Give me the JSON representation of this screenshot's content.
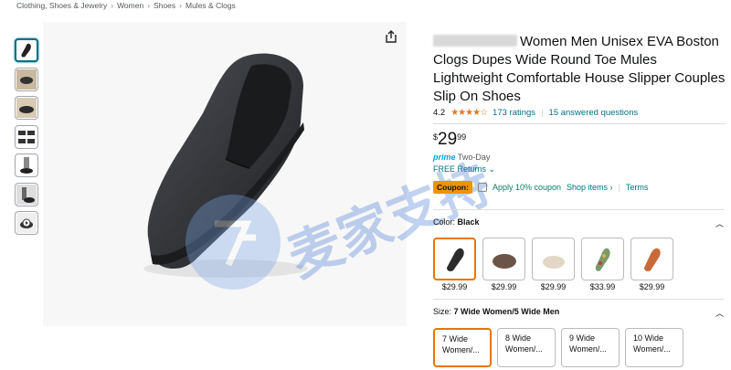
{
  "breadcrumb": [
    "Clothing, Shoes & Jewelry",
    "Women",
    "Shoes",
    "Mules & Clogs"
  ],
  "product": {
    "title": "Women Men Unisex EVA Boston Clogs Dupes Wide Round Toe Mules Lightweight Comfortable House Slipper Couples Slip On Shoes",
    "rating": "4.2",
    "ratings_count": "173 ratings",
    "questions": "15 answered questions",
    "price_symbol": "$",
    "price_whole": "29",
    "price_cents": "99",
    "prime_text": "Two-Day",
    "prime_label": "prime",
    "free_returns": "FREE Returns",
    "coupon_badge": "Coupon:",
    "coupon_text": "Apply 10% coupon",
    "shop_items": "Shop items ›",
    "terms": "Terms"
  },
  "color_section": {
    "label": "Color:",
    "value": "Black"
  },
  "swatches": [
    {
      "color": "#2b2b2b",
      "price": "$29.99"
    },
    {
      "color": "#6b5548",
      "price": "$29.99"
    },
    {
      "color": "#e2d7c6",
      "price": "$29.99"
    },
    {
      "color": "#7a9a6a",
      "price": "$33.99"
    },
    {
      "color": "#c96a3a",
      "price": "$29.99"
    }
  ],
  "size_section": {
    "label": "Size:",
    "value": "7 Wide Women/5 Wide Men"
  },
  "sizes": [
    {
      "line1": "7 Wide",
      "line2": "Women/..."
    },
    {
      "line1": "8 Wide",
      "line2": "Women/..."
    },
    {
      "line1": "9 Wide",
      "line2": "Women/..."
    },
    {
      "line1": "10 Wide",
      "line2": "Women/..."
    }
  ],
  "watermark_text": "麦家支持"
}
